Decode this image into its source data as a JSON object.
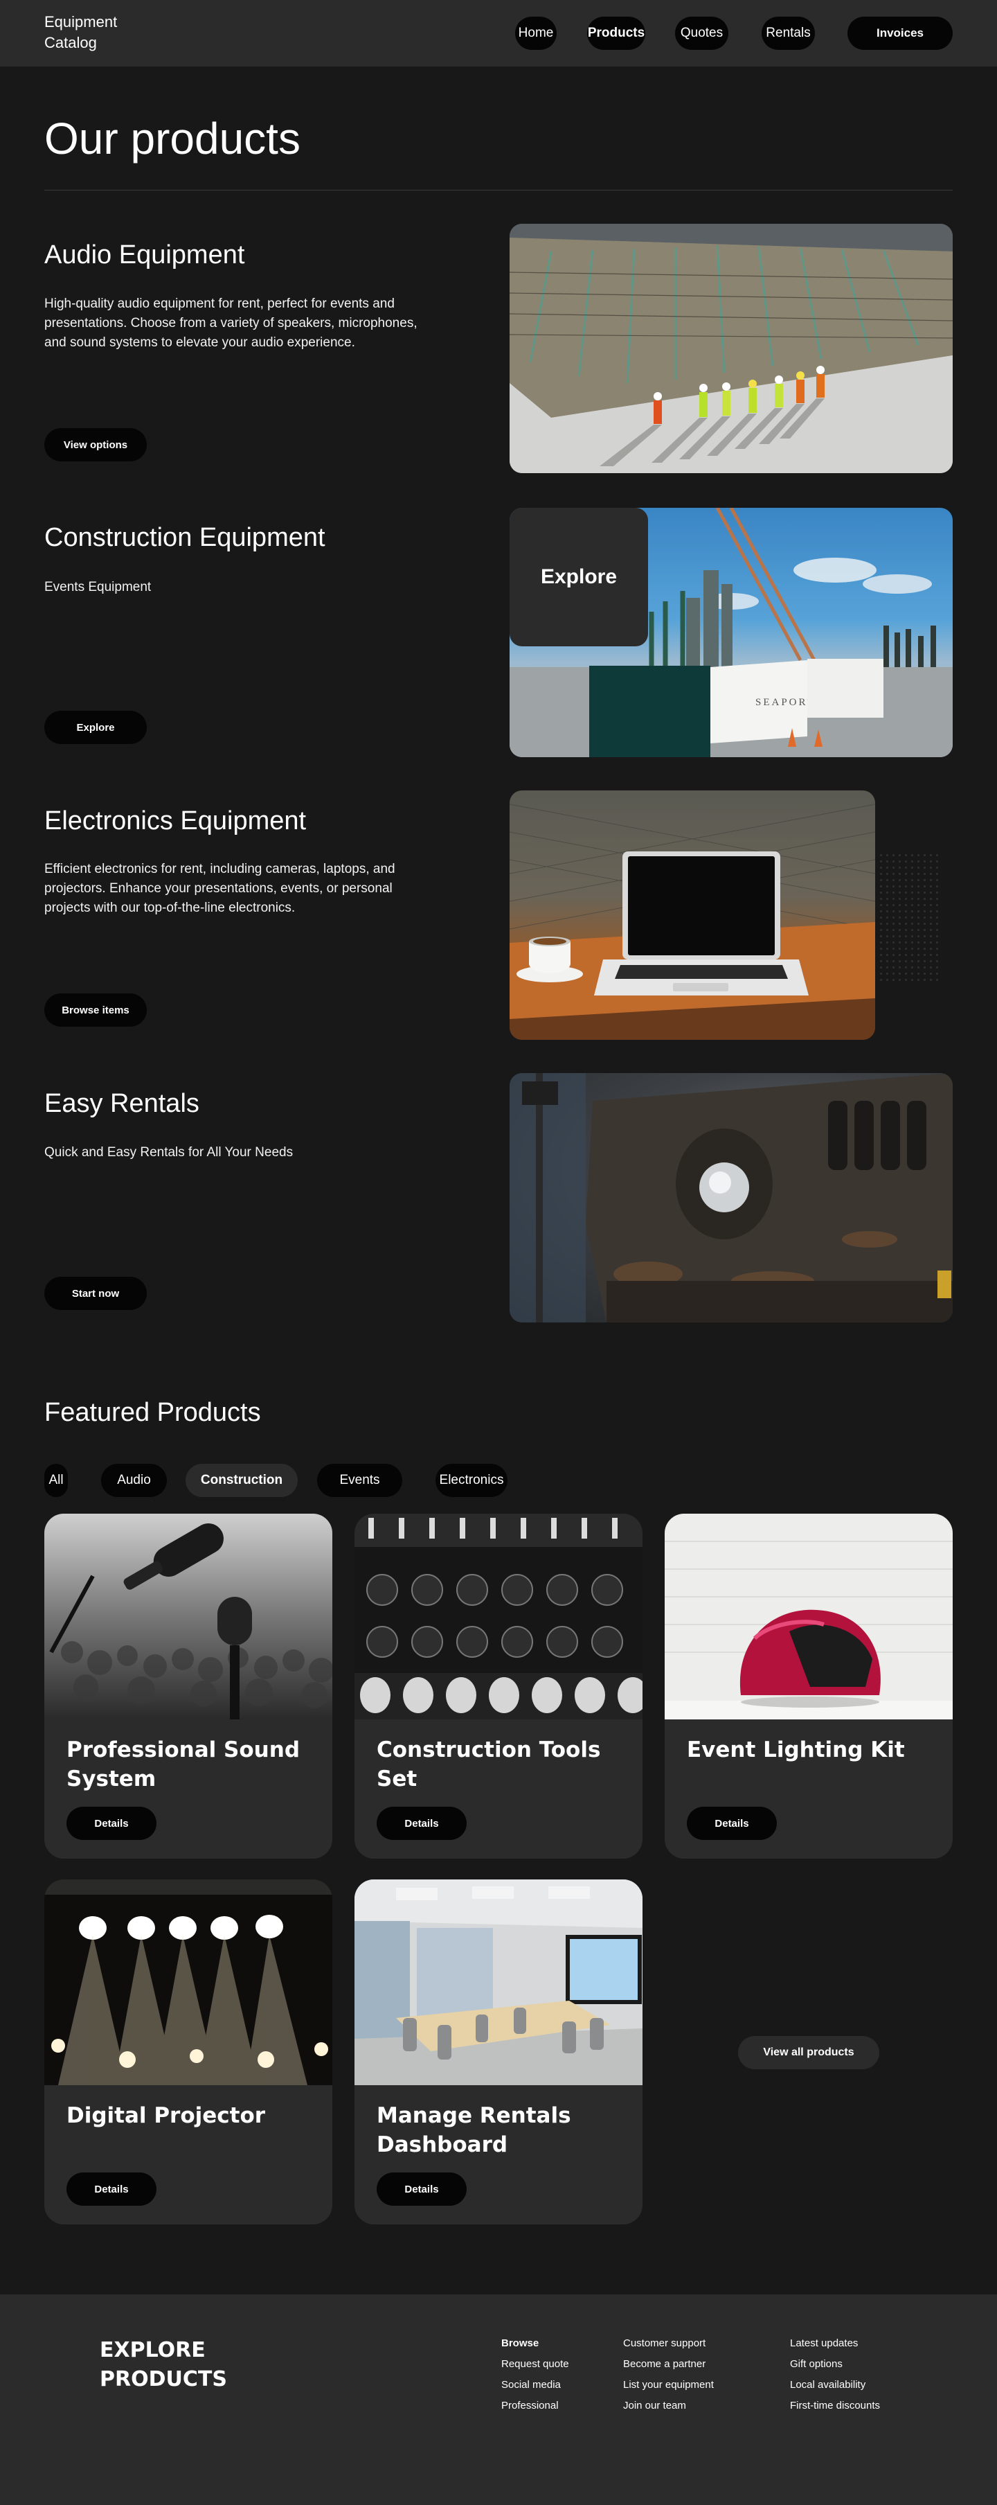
{
  "header": {
    "brand": "Equipment Catalog",
    "nav": {
      "home": "Home",
      "products": "Products",
      "quotes": "Quotes",
      "rentals": "Rentals",
      "invoices": "Invoices"
    }
  },
  "page": {
    "title": "Our products"
  },
  "categories": [
    {
      "heading": "Audio Equipment",
      "text": "High-quality audio equipment for rent, perfect for events and presentations. Choose from a variety of speakers, microphones, and sound systems to elevate your audio experience.",
      "button": "View options"
    },
    {
      "heading": "Construction Equipment",
      "text": "Events Equipment",
      "button": "Explore",
      "overlay": "Explore"
    },
    {
      "heading": "Electronics Equipment",
      "text": "Efficient electronics for rent, including cameras, laptops, and projectors. Enhance your presentations, events, or personal projects with our top-of-the-line electronics.",
      "button": "Browse items"
    },
    {
      "heading": "Easy Rentals",
      "text": "Quick and Easy Rentals for All Your Needs",
      "button": "Start now"
    }
  ],
  "images": {
    "site_sign": "SEAPORT"
  },
  "featured": {
    "title": "Featured Products",
    "filters": [
      "All",
      "Audio",
      "Construction",
      "Events",
      "Electronics"
    ],
    "active_filter": "Construction",
    "cards": [
      {
        "title": "Professional Sound System",
        "button": "Details"
      },
      {
        "title": "Construction Tools Set",
        "button": "Details"
      },
      {
        "title": "Event Lighting Kit",
        "button": "Details"
      },
      {
        "title": "Digital Projector",
        "button": "Details"
      },
      {
        "title": "Manage Rentals Dashboard",
        "button": "Details"
      }
    ],
    "view_all": "View all products"
  },
  "footer": {
    "brand": "EXPLORE PRODUCTS",
    "columns": [
      [
        "Browse",
        "Request quote",
        "Social media",
        "Professional"
      ],
      [
        "Customer support",
        "Become a partner",
        "List your equipment",
        "Join our team"
      ],
      [
        "Latest updates",
        "Gift options",
        "Local availability",
        "First-time discounts"
      ]
    ]
  },
  "colors": {
    "page_bg": "#181818",
    "surface": "#2b2b2b",
    "button": "#050505",
    "text": "#ffffff"
  }
}
